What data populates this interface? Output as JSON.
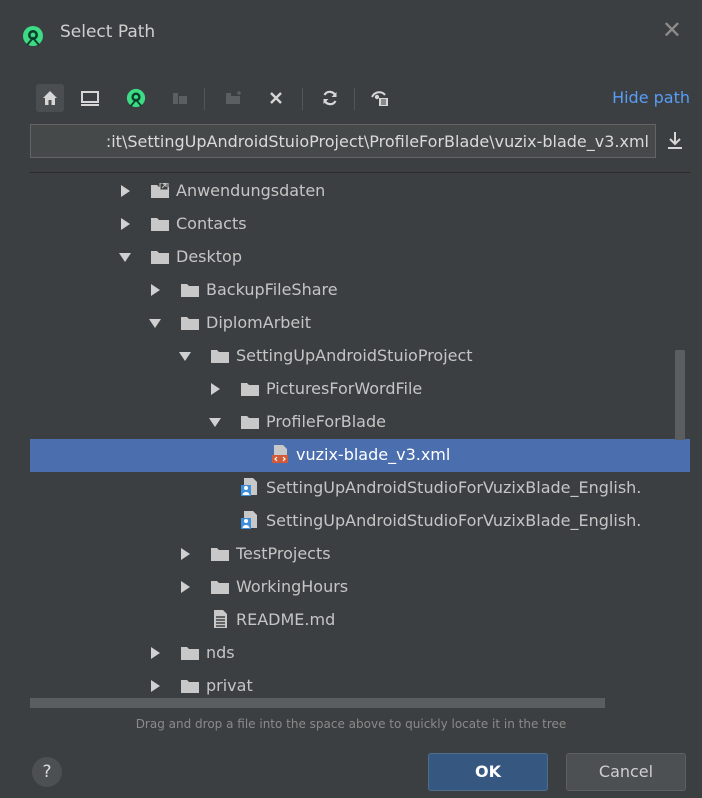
{
  "window": {
    "title": "Select Path",
    "close_icon": "close-icon"
  },
  "toolbar": {
    "hide_path_label": "Hide path",
    "icons": [
      "home-icon",
      "desktop-icon",
      "android-project-icon",
      "module-icon",
      "new-folder-icon",
      "delete-icon",
      "refresh-icon",
      "show-hidden-icon"
    ]
  },
  "path": {
    "value": ":it\\SettingUpAndroidStuioProject\\ProfileForBlade\\vuzix-blade_v3.xml"
  },
  "tree": {
    "items": [
      {
        "label": "Anwendungsdaten",
        "icon": "folder-link-icon",
        "expanded": false
      },
      {
        "label": "Contacts",
        "icon": "folder-icon",
        "expanded": false
      },
      {
        "label": "Desktop",
        "icon": "folder-icon",
        "expanded": true
      },
      {
        "label": "BackupFileShare",
        "icon": "folder-icon",
        "expanded": false
      },
      {
        "label": "DiplomArbeit",
        "icon": "folder-icon",
        "expanded": true
      },
      {
        "label": "SettingUpAndroidStuioProject",
        "icon": "folder-icon",
        "expanded": true
      },
      {
        "label": "PicturesForWordFile",
        "icon": "folder-icon",
        "expanded": false
      },
      {
        "label": "ProfileForBlade",
        "icon": "folder-icon",
        "expanded": true
      },
      {
        "label": "vuzix-blade_v3.xml",
        "icon": "xml-file-icon",
        "selected": true
      },
      {
        "label": "SettingUpAndroidStudioForVuzixBlade_English.",
        "icon": "word-file-icon"
      },
      {
        "label": "SettingUpAndroidStudioForVuzixBlade_English.",
        "icon": "word-file-icon"
      },
      {
        "label": "TestProjects",
        "icon": "folder-icon",
        "expanded": false
      },
      {
        "label": "WorkingHours",
        "icon": "folder-icon",
        "expanded": false
      },
      {
        "label": "README.md",
        "icon": "text-file-icon"
      },
      {
        "label": "nds",
        "icon": "folder-icon",
        "expanded": false
      },
      {
        "label": "privat",
        "icon": "folder-icon",
        "expanded": false
      }
    ]
  },
  "hint": "Drag and drop a file into the space above to quickly locate it in the tree",
  "buttons": {
    "help": "?",
    "ok": "OK",
    "cancel": "Cancel"
  },
  "colors": {
    "background": "#3c3f41",
    "selection": "#4b6eaf",
    "link": "#589df6",
    "ok_button": "#365880"
  }
}
